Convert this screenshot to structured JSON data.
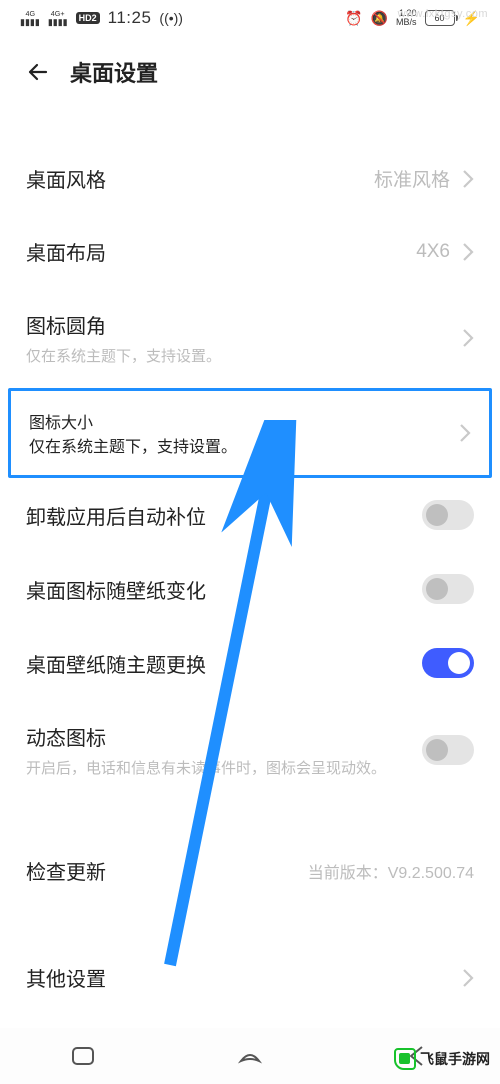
{
  "status": {
    "sig1_top": "4G",
    "sig2_top": "4G+",
    "hd": "HD",
    "hd_num": "2",
    "time": "11:25",
    "speed_top": "1.20",
    "speed_bot": "MB/s",
    "battery": "60"
  },
  "header": {
    "title": "桌面设置"
  },
  "items": {
    "style": {
      "label": "桌面风格",
      "value": "标准风格"
    },
    "layout": {
      "label": "桌面布局",
      "value": "4X6"
    },
    "corner": {
      "label": "图标圆角",
      "sub": "仅在系统主题下，支持设置。"
    },
    "size": {
      "label": "图标大小",
      "sub": "仅在系统主题下，支持设置。"
    },
    "autofill": {
      "label": "卸载应用后自动补位",
      "on": false
    },
    "iconWall": {
      "label": "桌面图标随壁纸变化",
      "on": false
    },
    "wallTheme": {
      "label": "桌面壁纸随主题更换",
      "on": true
    },
    "dynamic": {
      "label": "动态图标",
      "sub": "开启后，电话和信息有未读事件时，图标会呈现动效。",
      "on": false
    },
    "update": {
      "label": "检查更新",
      "value": "当前版本：V9.2.500.74"
    },
    "other": {
      "label": "其他设置"
    }
  },
  "watermark": {
    "top": "www.lxktgsy.com",
    "bottom": "飞鼠手游网"
  }
}
